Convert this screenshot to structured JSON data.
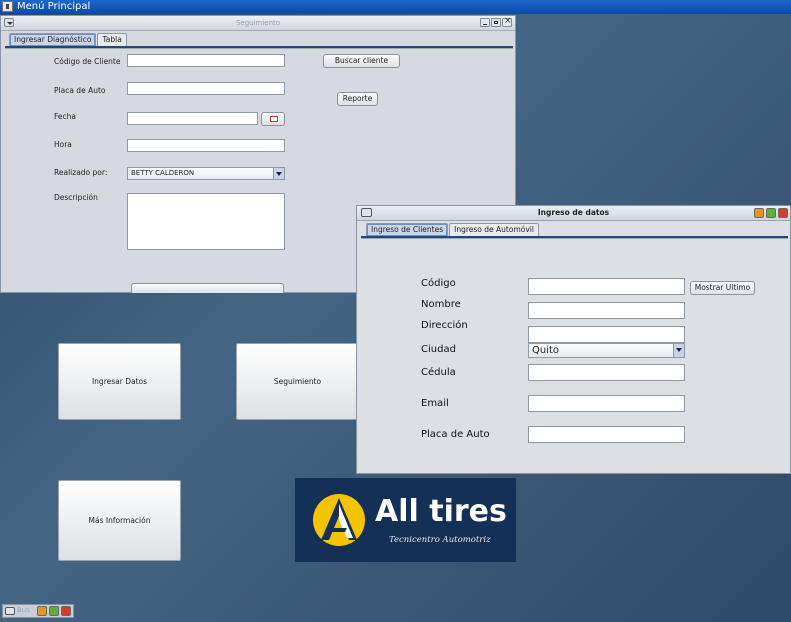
{
  "main_window": {
    "title": "Menú Principal"
  },
  "seguimiento": {
    "title": "Seguimiento",
    "tabs": [
      "Ingresar Diagnóstico",
      "Tabla"
    ],
    "labels": {
      "codigo": "Código de Cliente",
      "placa": "Placa de Auto",
      "fecha": "Fecha",
      "hora": "Hora",
      "realizado": "Realizado por:",
      "descripcion": "Descripción"
    },
    "realizado_value": "BETTY CALDERON",
    "buttons": {
      "buscar": "Buscar cliente",
      "reporte": "Reporte"
    }
  },
  "desktop_buttons": {
    "ingresar": "Ingresar Datos",
    "seguimiento": "Seguimiento",
    "info": "Más Información"
  },
  "logo": {
    "name": "All tires",
    "tagline": "Tecnicentro Automotriz"
  },
  "ingreso": {
    "title": "Ingreso de datos",
    "tabs": [
      "Ingreso de Clientes",
      "Ingreso de Automóvil"
    ],
    "labels": {
      "codigo": "Código",
      "nombre": "Nombre",
      "direccion": "Dirección",
      "ciudad": "Ciudad",
      "cedula": "Cédula",
      "email": "Email",
      "placa": "Placa de Auto"
    },
    "ciudad_value": "Quito",
    "buttons": {
      "mostrar": "Mostrar Ultimo"
    }
  },
  "minimized": {
    "label": "Bus"
  },
  "colors": {
    "titlebar": "#0b4aa8",
    "logo_bg": "#143057",
    "logo_yellow": "#f5c400"
  }
}
